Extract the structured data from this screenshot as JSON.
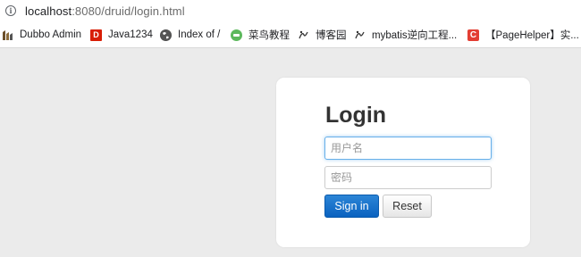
{
  "address_bar": {
    "url_host": "localhost",
    "url_rest": ":8080/druid/login.html"
  },
  "bookmarks": [
    {
      "label": "Dubbo Admin",
      "icon": "dubbo-icon"
    },
    {
      "label": "Java1234",
      "icon": "java1234-icon",
      "glyph": "D"
    },
    {
      "label": "Index of /",
      "icon": "globe-icon"
    },
    {
      "label": "菜鸟教程",
      "icon": "runoob-icon"
    },
    {
      "label": "博客园",
      "icon": "cnblogs-icon"
    },
    {
      "label": "mybatis逆向工程...",
      "icon": "cnblogs-icon"
    },
    {
      "label": "【PageHelper】实...",
      "icon": "csdn-icon",
      "glyph": "C"
    }
  ],
  "login": {
    "title": "Login",
    "username_placeholder": "用户名",
    "password_placeholder": "密码",
    "signin_label": "Sign in",
    "reset_label": "Reset"
  },
  "colors": {
    "primary_button": "#0a62c0",
    "page_background": "#ebebeb",
    "focus_border": "#66afe9"
  }
}
